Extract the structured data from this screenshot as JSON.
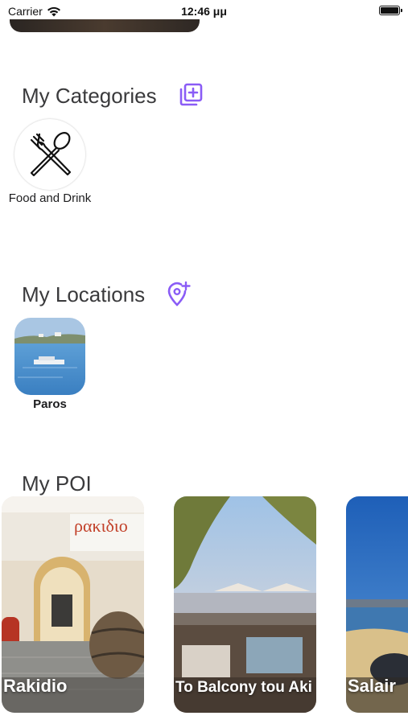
{
  "status_bar": {
    "carrier": "Carrier",
    "time": "12:46 μμ"
  },
  "categories": {
    "title": "My Categories",
    "add_icon": "add-square-icon",
    "items": [
      {
        "label": "Food and Drink",
        "icon": "fork-spoon-icon"
      }
    ]
  },
  "locations": {
    "title": "My Locations",
    "add_icon": "add-location-pin-icon",
    "items": [
      {
        "label": "Paros"
      }
    ]
  },
  "poi": {
    "title": "My POI",
    "items": [
      {
        "label": "Rakidio"
      },
      {
        "label": "To Balcony tou Aki"
      },
      {
        "label": "Salair"
      }
    ]
  },
  "colors": {
    "accent": "#8a5cf6",
    "text": "#3a3a3c"
  }
}
